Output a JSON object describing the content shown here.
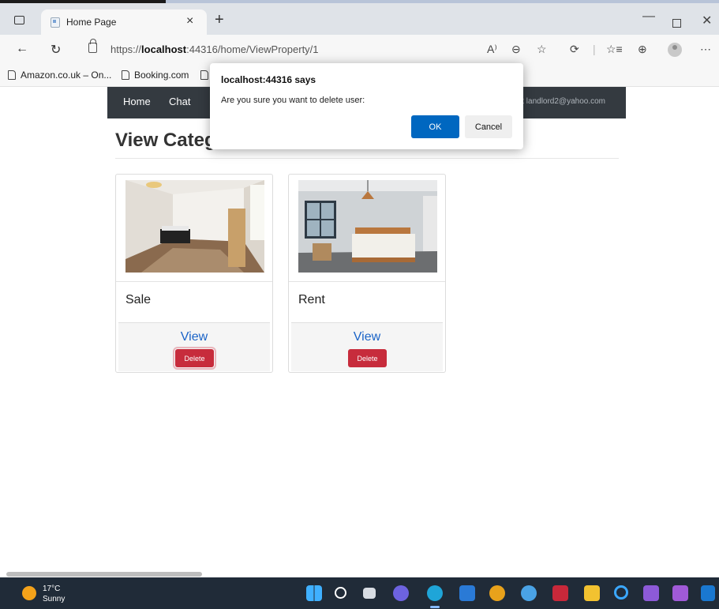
{
  "browser": {
    "tab_title": "Home Page",
    "tab_close": "×",
    "new_tab": "+",
    "url_prefix": "https://",
    "url_host": "localhost",
    "url_rest": ":44316/home/ViewProperty/1",
    "window_minimize": "—",
    "window_close": "✕",
    "toolbar_icons": [
      "A⁾",
      "⊖",
      "☆",
      "⟳",
      "|",
      "☆≡",
      "⊕",
      "⋯"
    ]
  },
  "bookmarks": [
    {
      "label": "Amazon.co.uk – On..."
    },
    {
      "label": "Booking.com"
    }
  ],
  "navbar": {
    "items": [
      "Home",
      "Chat"
    ],
    "user_text": "ut landlord2@yahoo.com"
  },
  "page": {
    "title": "View Categ"
  },
  "cards": [
    {
      "title": "Sale",
      "view_label": "View",
      "delete_label": "Delete"
    },
    {
      "title": "Rent",
      "view_label": "View",
      "delete_label": "Delete"
    }
  ],
  "dialog": {
    "title": "localhost:44316 says",
    "message": "Are you sure you want to delete user:",
    "ok_label": "OK",
    "cancel_label": "Cancel"
  },
  "taskbar": {
    "temperature": "17°C",
    "condition": "Sunny",
    "apps": [
      "windows-start-icon",
      "search-icon",
      "task-view-icon",
      "chat-icon",
      "edge-icon",
      "store-icon",
      "chrome-icon",
      "app-icon",
      "mcafee-icon",
      "file-explorer-icon",
      "cortana-icon",
      "visual-studio-icon",
      "visual-studio-alt-icon",
      "outlook-icon"
    ]
  },
  "colors": {
    "navbar_bg": "#343a40",
    "link_blue": "#1a63c7",
    "danger_red": "#c72c3c",
    "dialog_ok_blue": "#0067c0",
    "taskbar_bg": "#202b38"
  }
}
